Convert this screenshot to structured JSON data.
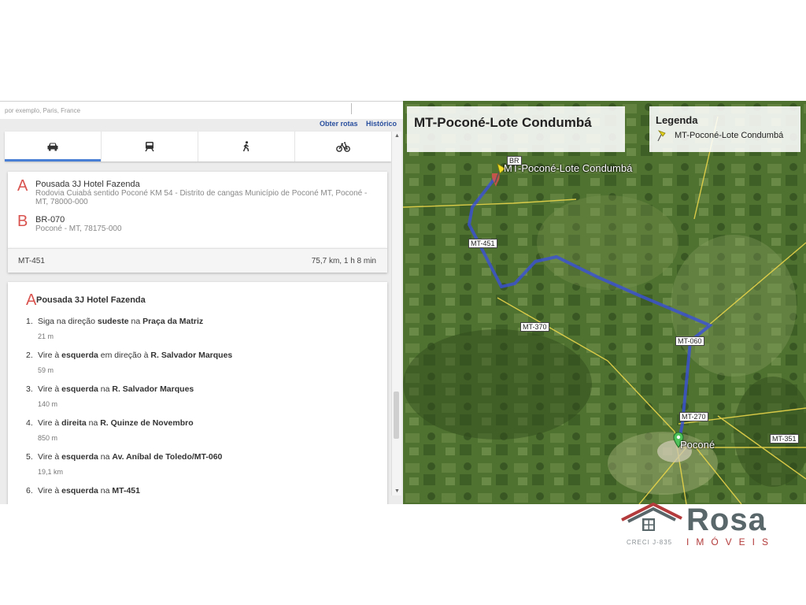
{
  "search": {
    "placeholder": "por exemplo, Paris, France"
  },
  "links": {
    "get_directions": "Obter rotas",
    "history": "Histórico"
  },
  "modes": [
    {
      "id": "car",
      "icon": "car-icon"
    },
    {
      "id": "transit",
      "icon": "transit-icon"
    },
    {
      "id": "walk",
      "icon": "walk-icon"
    },
    {
      "id": "bike",
      "icon": "bike-icon"
    }
  ],
  "route": {
    "a": {
      "letter": "A",
      "name": "Pousada 3J Hotel Fazenda",
      "address": "Rodovia Cuiabá sentido Poconé KM 54 - Distrito de cangas Município de Poconé MT, Poconé - MT, 78000-000"
    },
    "b": {
      "letter": "B",
      "name": "BR-070",
      "address": "Poconé - MT, 78175-000"
    }
  },
  "summary": {
    "road": "MT-451",
    "distance_time": "75,7 km, 1 h 8 min"
  },
  "steps_card": {
    "start_letter": "A",
    "start_name": "Pousada 3J Hotel Fazenda",
    "steps": [
      {
        "num": "1.",
        "pre": "Siga na direção ",
        "b1": "sudeste",
        "mid": " na ",
        "b2": "Praça da Matriz",
        "dist": "21 m"
      },
      {
        "num": "2.",
        "pre": "Vire à ",
        "b1": "esquerda",
        "mid": " em direção à ",
        "b2": "R. Salvador Marques",
        "dist": "59 m"
      },
      {
        "num": "3.",
        "pre": "Vire à ",
        "b1": "esquerda",
        "mid": " na ",
        "b2": "R. Salvador Marques",
        "dist": "140 m"
      },
      {
        "num": "4.",
        "pre": "Vire à ",
        "b1": "direita",
        "mid": " na ",
        "b2": "R. Quinze de Novembro",
        "dist": "850 m"
      },
      {
        "num": "5.",
        "pre": "Vire à ",
        "b1": "esquerda",
        "mid": " na ",
        "b2": "Av. Aníbal de Toledo/MT-060",
        "dist": "19,1 km"
      },
      {
        "num": "6.",
        "pre": "Vire à ",
        "b1": "esquerda",
        "mid": " na ",
        "b2": "MT-451",
        "dist": ""
      }
    ]
  },
  "map": {
    "title": "MT-Poconé-Lote Condumbá",
    "legend_title": "Legenda",
    "legend_item": "MT-Poconé-Lote Condumbá",
    "marker_label": "MT-Poconé-Lote Condumbá",
    "town_label": "Poconé",
    "road_labels": {
      "mt451": "MT-451",
      "mt370": "MT-370",
      "mt060": "MT-060",
      "mt270": "MT-270",
      "mt351": "MT-351",
      "br": "BR"
    }
  },
  "logo": {
    "name": "Rosa",
    "creci": "CRECI J-835",
    "tagline": "IMÓVEIS"
  }
}
